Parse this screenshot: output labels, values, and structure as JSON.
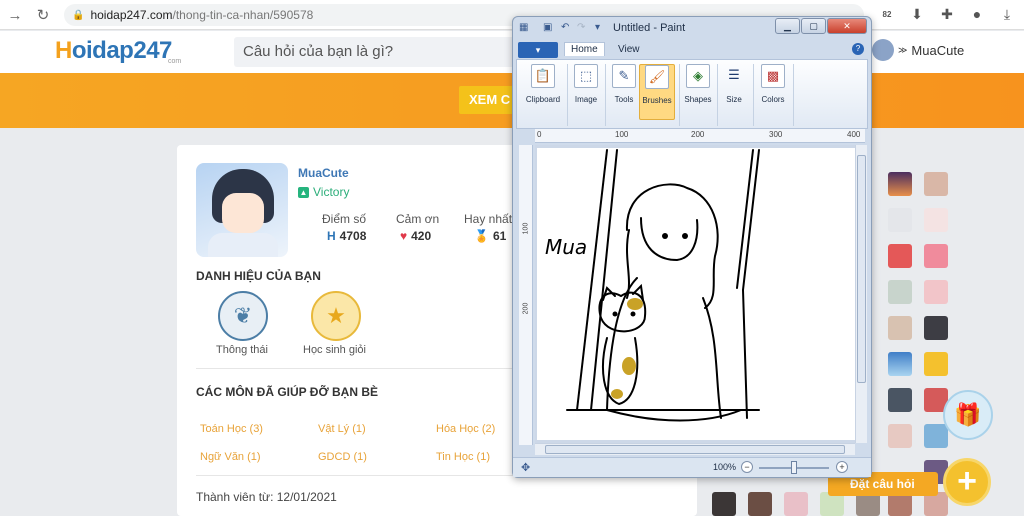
{
  "browser": {
    "url_domain": "hoidap247.com",
    "url_path": "/thong-tin-ca-nhan/590578",
    "ext_badge": "82"
  },
  "site": {
    "logo_main": "oidap247",
    "logo_h": "H",
    "logo_sub": "com",
    "search_placeholder": "Câu hỏi của bạn là gì?",
    "header_user": "MuaCute",
    "banner_btn": "XEM C"
  },
  "profile": {
    "username": "MuaCute",
    "rank": "Victory",
    "stats": [
      {
        "label": "Điểm số",
        "value": "4708",
        "icon": "H"
      },
      {
        "label": "Cảm ơn",
        "value": "420",
        "icon": "♥"
      },
      {
        "label": "Hay nhất",
        "value": "61",
        "icon": "🏅"
      }
    ],
    "titles_heading": "DANH HIỆU CỦA BẠN",
    "badges": [
      {
        "label": "Thông thái",
        "icon": "❦"
      },
      {
        "label": "Học sinh giỏi",
        "icon": "★"
      }
    ],
    "subjects_heading": "CÁC MÔN ĐÃ GIÚP ĐỠ BẠN BÈ",
    "subjects": [
      "Toán Học (3)",
      "Vật Lý (1)",
      "Hóa Học (2)",
      "Ngữ Văn (1)",
      "GDCD (1)",
      "Tin Học (1)"
    ],
    "member_since": "Thành viên từ: 12/01/2021"
  },
  "side": {
    "ask_btn": "Đặt câu hỏi",
    "plus": "+"
  },
  "paint": {
    "title": "Untitled - Paint",
    "file_tab": "▾",
    "tabs": [
      "Home",
      "View"
    ],
    "groups": [
      "Clipboard",
      "Image",
      "Tools",
      "Brushes",
      "Shapes",
      "Size",
      "Colors"
    ],
    "ruler_h": [
      "0",
      "100",
      "200",
      "300",
      "400"
    ],
    "ruler_v": [
      "100",
      "200"
    ],
    "zoom": "100%",
    "signature": "Mua"
  }
}
